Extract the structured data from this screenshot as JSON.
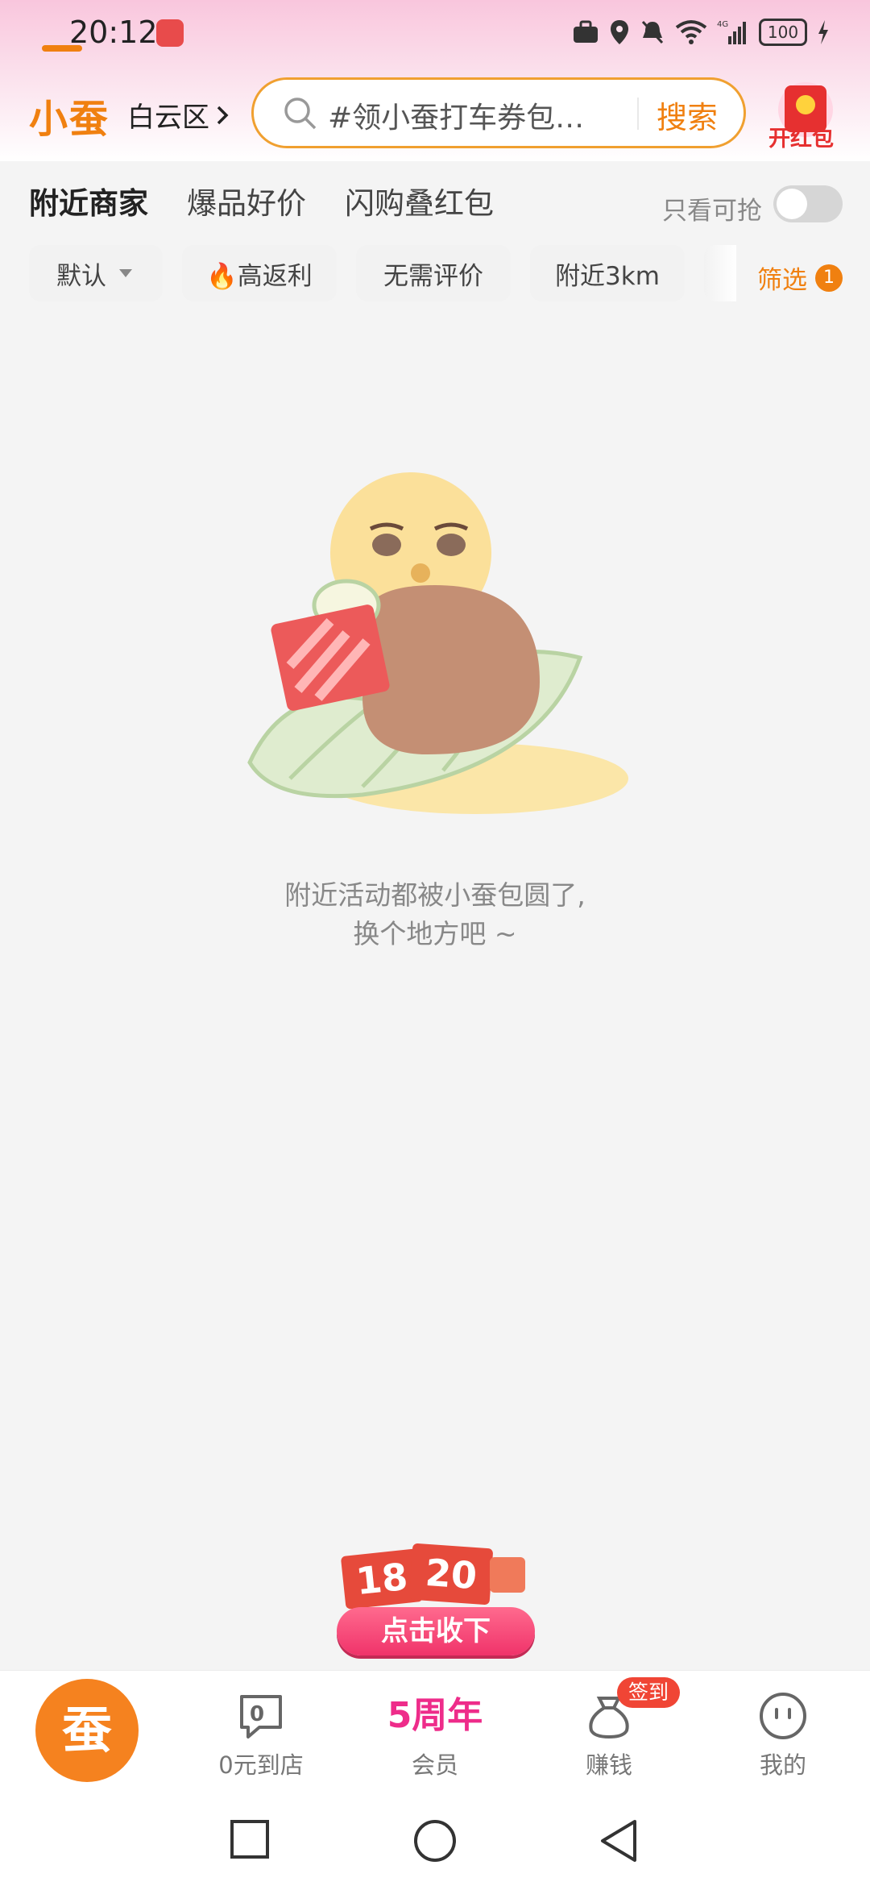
{
  "status_bar": {
    "time": "20:12",
    "battery": "100",
    "network": "4G"
  },
  "header": {
    "logo": "小蚕",
    "location": "白云区",
    "search_placeholder": "#领小蚕打车券包…",
    "search_button": "搜索",
    "hongbao_label": "开红包"
  },
  "tabs": [
    {
      "label": "附近商家",
      "active": true
    },
    {
      "label": "爆品好价",
      "active": false
    },
    {
      "label": "闪购叠红包",
      "active": false
    }
  ],
  "only_grab_label": "只看可抢",
  "only_grab_on": false,
  "chips": [
    {
      "label": "默认"
    },
    {
      "label": "🔥高返利"
    },
    {
      "label": "无需评价"
    },
    {
      "label": "附近3km"
    }
  ],
  "filter": {
    "label": "筛选",
    "count": "1"
  },
  "empty_state": {
    "line1": "附近活动都被小蚕包圆了,",
    "line2": "换个地方吧 ~"
  },
  "promo": {
    "num1": "18",
    "num2": "20",
    "button": "点击收下"
  },
  "bottom_nav": {
    "home_glyph": "蚕",
    "items": [
      {
        "label": "0元到店",
        "icon": "chat-zero-icon"
      },
      {
        "label": "会员",
        "highlight": "5周年"
      },
      {
        "label": "赚钱",
        "badge": "签到",
        "icon": "moneybag-icon"
      },
      {
        "label": "我的",
        "icon": "face-icon"
      }
    ]
  },
  "colors": {
    "accent": "#f08010",
    "pink": "#ee2c8a",
    "red": "#e64a3b"
  }
}
